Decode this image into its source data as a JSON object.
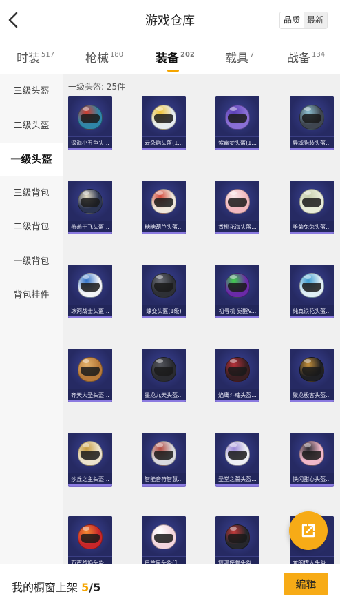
{
  "header": {
    "title": "游戏仓库",
    "sort_options": [
      "品质",
      "最新"
    ]
  },
  "tabs": [
    {
      "label": "时装",
      "count": "517"
    },
    {
      "label": "枪械",
      "count": "180"
    },
    {
      "label": "装备",
      "count": "202"
    },
    {
      "label": "载具",
      "count": "7"
    },
    {
      "label": "战备",
      "count": "134"
    }
  ],
  "active_tab": 2,
  "sidebar": {
    "items": [
      {
        "label": "三级头盔"
      },
      {
        "label": "二级头盔"
      },
      {
        "label": "一级头盔"
      },
      {
        "label": "三级背包"
      },
      {
        "label": "二级背包"
      },
      {
        "label": "一级背包"
      },
      {
        "label": "背包挂件"
      }
    ],
    "active_index": 2
  },
  "content": {
    "section_label": "一级头盔: 25件",
    "items": [
      {
        "name": "深海小丑鱼头...",
        "color": "#2f86a8",
        "accent": "#d33b2c"
      },
      {
        "name": "云朵鹦头盔(1...",
        "color": "#e6ecef",
        "accent": "#f1c232"
      },
      {
        "name": "紫幽梦头盔(1...",
        "color": "#8a6fd6",
        "accent": "#5b3fb5"
      },
      {
        "name": "异域猎装头盔...",
        "color": "#3f4650",
        "accent": "#8fc3d4"
      },
      {
        "name": "燕燕于飞头盔...",
        "color": "#2c3552",
        "accent": "#e9e1c8"
      },
      {
        "name": "糖糖葫芦头盔...",
        "color": "#efe7dc",
        "accent": "#d4493a"
      },
      {
        "name": "香桃花海头盔...",
        "color": "#f1b8bf",
        "accent": "#f7e6e8"
      },
      {
        "name": "雏菊兔兔头盔...",
        "color": "#e8ecd8",
        "accent": "#c7cfae"
      },
      {
        "name": "冰河战士头盔...",
        "color": "#f2f4f7",
        "accent": "#2c6fc7"
      },
      {
        "name": "蝶变头盔(1级)",
        "color": "#2e3036",
        "accent": "#6a6d75"
      },
      {
        "name": "初号机 觉醒V...",
        "color": "#6a2aa8",
        "accent": "#3fcf4a"
      },
      {
        "name": "纯真浪花头盔...",
        "color": "#dfeef5",
        "accent": "#3a9bd1"
      },
      {
        "name": "齐天大圣头盔...",
        "color": "#b87a3a",
        "accent": "#e2b06a"
      },
      {
        "name": "墨龙九天头盔...",
        "color": "#2a2b30",
        "accent": "#55575e"
      },
      {
        "name": "焰鹰斗魂头盔...",
        "color": "#3a1f22",
        "accent": "#b8323a"
      },
      {
        "name": "聚龙极客头盔...",
        "color": "#1f2024",
        "accent": "#c9923a"
      },
      {
        "name": "沙丘之主头盔...",
        "color": "#ece3cd",
        "accent": "#c79b3c"
      },
      {
        "name": "智能音符智慧...",
        "color": "#d9dadf",
        "accent": "#b3473c"
      },
      {
        "name": "圣堂之誓头盔...",
        "color": "#eef0f5",
        "accent": "#9a86d6"
      },
      {
        "name": "快闪甜心头盔...",
        "color": "#f0b7c9",
        "accent": "#2a2a30"
      },
      {
        "name": "万古烈焰头盔...",
        "color": "#c8262a",
        "accent": "#f08a30"
      },
      {
        "name": "白兰星头盔(1...",
        "color": "#f4d6de",
        "accent": "#ffffff"
      },
      {
        "name": "惊鸿侠骨头盔...",
        "color": "#26272c",
        "accent": "#c33a3a"
      },
      {
        "name": "龙的传人头盔...",
        "color": "#d6a832",
        "accent": "#b23030"
      }
    ]
  },
  "fab": {
    "icon": "share-external-icon"
  },
  "bottom": {
    "shelf_label": "我的橱窗上架",
    "shelf_current": "5",
    "shelf_separator": "/",
    "shelf_total": "5",
    "edit_label": "编辑"
  }
}
